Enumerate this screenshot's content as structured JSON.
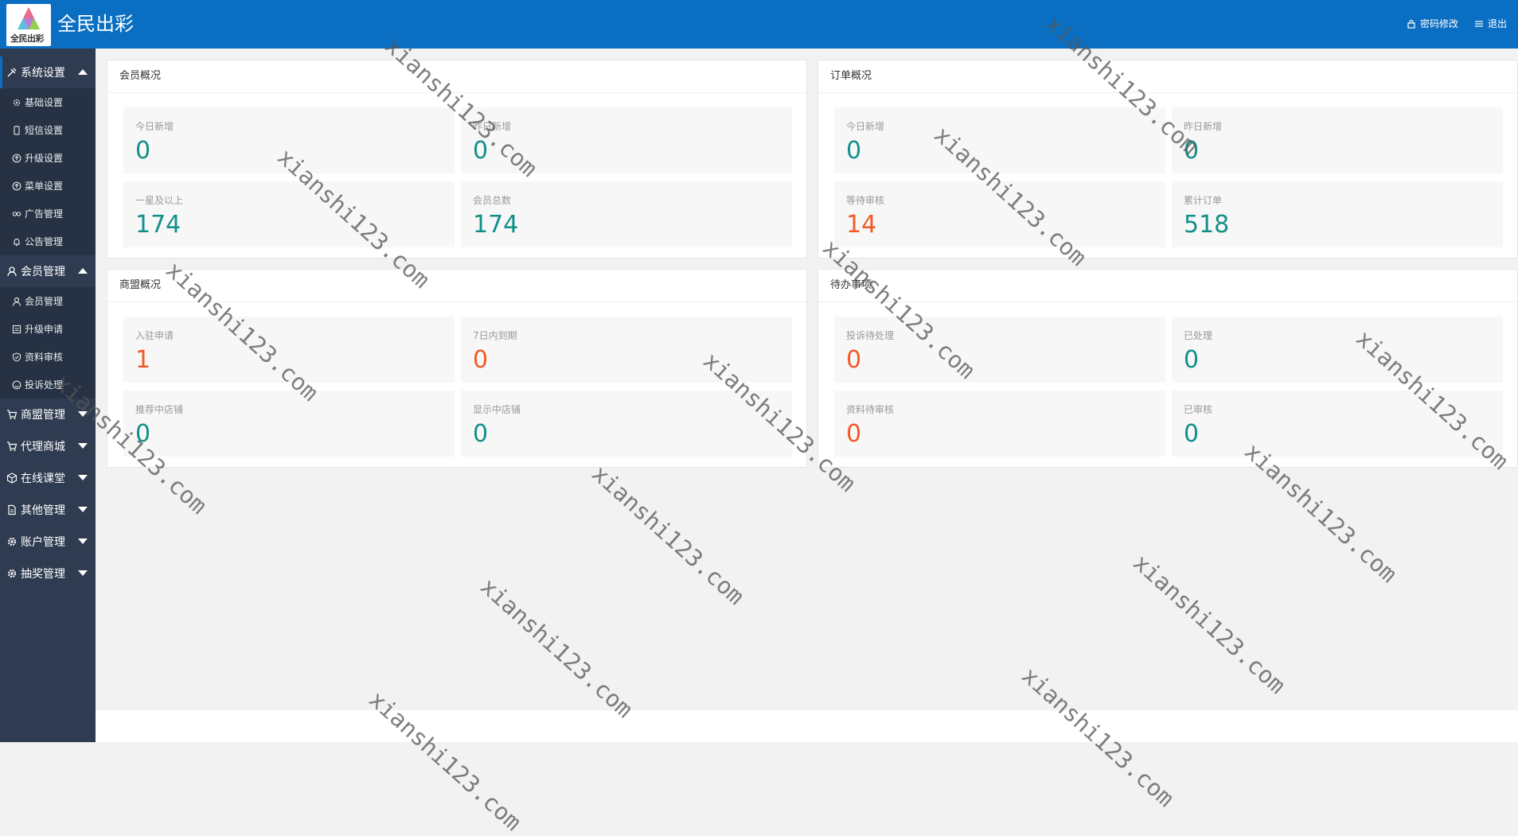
{
  "header": {
    "logo_text": "全民出彩",
    "title": "全民出彩",
    "password_label": "密码修改",
    "logout_label": "退出"
  },
  "sidebar": {
    "groups": [
      {
        "label": "系统设置",
        "expanded": true,
        "items": [
          "基础设置",
          "短信设置",
          "升级设置",
          "菜单设置",
          "广告管理",
          "公告管理"
        ]
      },
      {
        "label": "会员管理",
        "expanded": true,
        "items": [
          "会员管理",
          "升级申请",
          "资料审核",
          "投诉处理"
        ]
      },
      {
        "label": "商盟管理",
        "expanded": false
      },
      {
        "label": "代理商城",
        "expanded": false
      },
      {
        "label": "在线课堂",
        "expanded": false
      },
      {
        "label": "其他管理",
        "expanded": false
      },
      {
        "label": "账户管理",
        "expanded": false
      },
      {
        "label": "抽奖管理",
        "expanded": false
      }
    ]
  },
  "cards": {
    "member": {
      "title": "会员概况",
      "stats": [
        {
          "label": "今日新增",
          "value": "0"
        },
        {
          "label": "昨日新增",
          "value": "0"
        },
        {
          "label": "一星及以上",
          "value": "174"
        },
        {
          "label": "会员总数",
          "value": "174"
        }
      ]
    },
    "order": {
      "title": "订单概况",
      "stats": [
        {
          "label": "今日新增",
          "value": "0"
        },
        {
          "label": "昨日新增",
          "value": "0"
        },
        {
          "label": "等待审核",
          "value": "14"
        },
        {
          "label": "累计订单",
          "value": "518"
        }
      ]
    },
    "alliance": {
      "title": "商盟概况",
      "stats": [
        {
          "label": "入驻申请",
          "value": "1"
        },
        {
          "label": "7日内到期",
          "value": "0"
        },
        {
          "label": "推荐中店铺",
          "value": "0"
        },
        {
          "label": "显示中店铺",
          "value": "0"
        }
      ]
    },
    "todo": {
      "title": "待办事项",
      "stats": [
        {
          "label": "投诉待处理",
          "value": "0"
        },
        {
          "label": "已处理",
          "value": "0"
        },
        {
          "label": "资料待审核",
          "value": "0"
        },
        {
          "label": "已审核",
          "value": "0"
        }
      ]
    }
  },
  "colors": {
    "header_bg": "#0a6fc2",
    "sidebar_bg": "#2e3b50",
    "teal": "#11908a",
    "orange": "#f25a26"
  },
  "watermark_text": "xianshi123.com"
}
